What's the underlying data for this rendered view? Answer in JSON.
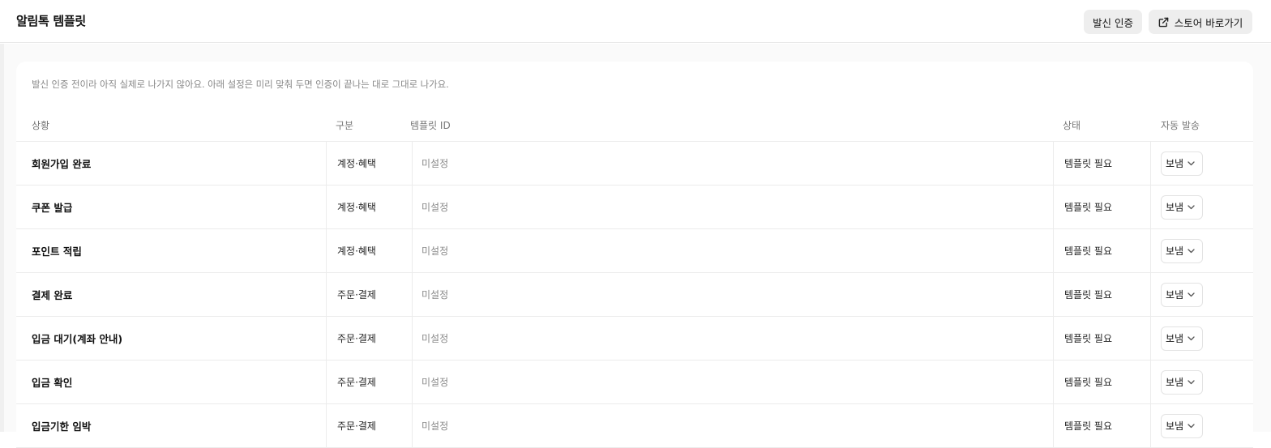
{
  "header": {
    "title": "알림톡 템플릿",
    "verify_button": "발신 인증",
    "store_button": "스토어 바로가기",
    "store_icon": "external-link-icon"
  },
  "notice": "발신 인증 전이라 아직 실제로 나가지 않아요. 아래 설정은 미리 맞춰 두면 인증이 끝나는 대로 그대로 나가요.",
  "table": {
    "columns": [
      "상황",
      "구분",
      "템플릿 ID",
      "상태",
      "자동 발송"
    ],
    "rows": [
      {
        "situation": "회원가입 완료",
        "category": "계정·혜택",
        "template_id": "미설정",
        "status": "템플릿 필요",
        "auto_send": "보냄"
      },
      {
        "situation": "쿠폰 발급",
        "category": "계정·혜택",
        "template_id": "미설정",
        "status": "템플릿 필요",
        "auto_send": "보냄"
      },
      {
        "situation": "포인트 적립",
        "category": "계정·혜택",
        "template_id": "미설정",
        "status": "템플릿 필요",
        "auto_send": "보냄"
      },
      {
        "situation": "결제 완료",
        "category": "주문·결제",
        "template_id": "미설정",
        "status": "템플릿 필요",
        "auto_send": "보냄"
      },
      {
        "situation": "입금 대기(계좌 안내)",
        "category": "주문·결제",
        "template_id": "미설정",
        "status": "템플릿 필요",
        "auto_send": "보냄"
      },
      {
        "situation": "입금 확인",
        "category": "주문·결제",
        "template_id": "미설정",
        "status": "템플릿 필요",
        "auto_send": "보냄"
      },
      {
        "situation": "입금기한 임박",
        "category": "주문·결제",
        "template_id": "미설정",
        "status": "템플릿 필요",
        "auto_send": "보냄"
      }
    ]
  }
}
